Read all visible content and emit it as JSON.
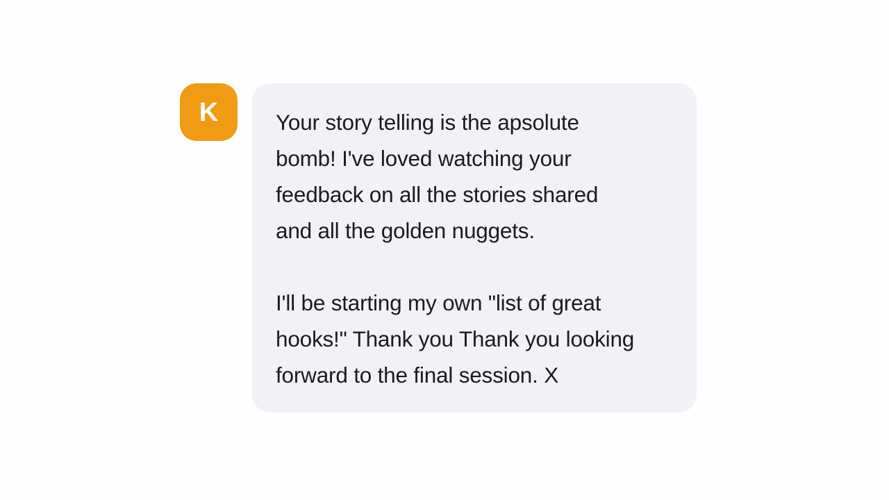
{
  "avatar": {
    "initial": "K",
    "color": "#f19a14"
  },
  "message": {
    "background": "#f2f2f6",
    "paragraphs": [
      {
        "lines": [
          "Your story telling is the apsolute",
          "bomb! I've loved watching your",
          "feedback on all the stories shared",
          "and all the golden nuggets."
        ]
      },
      {
        "lines": [
          "I'll be starting my own \"list of great",
          "hooks!\" Thank you Thank you looking",
          "forward to the final session. X"
        ]
      }
    ]
  }
}
